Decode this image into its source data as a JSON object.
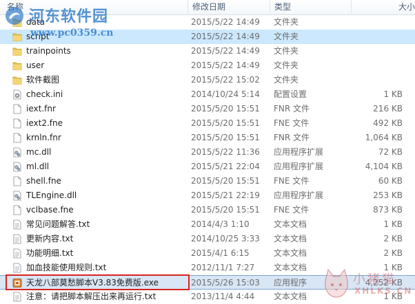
{
  "columns": {
    "name": "名称",
    "date": "修改日期",
    "type": "类型",
    "size": "大小"
  },
  "files": [
    {
      "name": "data",
      "date": "2015/5/22 14:49",
      "type": "文件夹",
      "size": "",
      "icon": "folder-icon"
    },
    {
      "name": "script",
      "date": "2015/5/22 14:49",
      "type": "文件夹",
      "size": "",
      "icon": "folder-icon"
    },
    {
      "name": "trainpoints",
      "date": "2015/5/22 14:49",
      "type": "文件夹",
      "size": "",
      "icon": "folder-icon"
    },
    {
      "name": "user",
      "date": "2015/5/22 14:49",
      "type": "文件夹",
      "size": "",
      "icon": "folder-icon"
    },
    {
      "name": "软件截图",
      "date": "2015/5/22 15:02",
      "type": "文件夹",
      "size": "",
      "icon": "folder-icon"
    },
    {
      "name": "check.ini",
      "date": "2014/10/24 5:14",
      "type": "配置设置",
      "size": "1 KB",
      "icon": "settings-file-icon"
    },
    {
      "name": "iext.fnr",
      "date": "2015/5/20 15:51",
      "type": "FNR 文件",
      "size": "216 KB",
      "icon": "file-icon"
    },
    {
      "name": "iext2.fne",
      "date": "2015/5/20 15:51",
      "type": "FNE 文件",
      "size": "492 KB",
      "icon": "file-icon"
    },
    {
      "name": "krnln.fnr",
      "date": "2015/5/20 15:51",
      "type": "FNR 文件",
      "size": "1,064 KB",
      "icon": "file-icon"
    },
    {
      "name": "mc.dll",
      "date": "2015/5/22 11:36",
      "type": "应用程序扩展",
      "size": "72 KB",
      "icon": "dll-icon"
    },
    {
      "name": "ml.dll",
      "date": "2015/5/21 22:04",
      "type": "应用程序扩展",
      "size": "4,104 KB",
      "icon": "dll-icon"
    },
    {
      "name": "shell.fne",
      "date": "2015/5/20 15:51",
      "type": "FNE 文件",
      "size": "60 KB",
      "icon": "file-icon"
    },
    {
      "name": "TLEngine.dll",
      "date": "2015/5/21 22:19",
      "type": "应用程序扩展",
      "size": "253 KB",
      "icon": "dll-icon"
    },
    {
      "name": "vclbase.fne",
      "date": "2015/5/20 15:51",
      "type": "FNE 文件",
      "size": "873 KB",
      "icon": "file-icon"
    },
    {
      "name": "常见问题解答.txt",
      "date": "2014/4/3 1:10",
      "type": "文本文档",
      "size": "1 KB",
      "icon": "text-file-icon"
    },
    {
      "name": "更新内容.txt",
      "date": "2014/10/25 3:33",
      "type": "文本文档",
      "size": "2 KB",
      "icon": "text-file-icon"
    },
    {
      "name": "功能明细.txt",
      "date": "2015/4/1 6:15",
      "type": "文本文档",
      "size": "2 KB",
      "icon": "text-file-icon"
    },
    {
      "name": "加血技能使用规则.txt",
      "date": "2012/11/1 7:27",
      "type": "文本文档",
      "size": "1 KB",
      "icon": "text-file-icon"
    },
    {
      "name": "天龙八部莫愁脚本V3.83免费版.exe",
      "date": "2015/5/26 15:03",
      "type": "应用程序",
      "size": "4,252 KB",
      "icon": "exe-icon"
    },
    {
      "name": "注意：请把脚本解压出来再运行.txt",
      "date": "2013/11/4 4:44",
      "type": "文本文档",
      "size": "1 KB",
      "icon": "text-file-icon"
    }
  ],
  "watermark_top": {
    "title": "河东软件园",
    "url": "www.pc0359.cn"
  },
  "watermark_bottom": {
    "title": "小猪猫",
    "url": "XHLKS.CN"
  },
  "colors": {
    "folder": "#e9c24e",
    "selection": "#d8e6f6",
    "selection_outline": "#d7241f",
    "hover": "#cce8ff",
    "header_text": "#4c607a"
  }
}
